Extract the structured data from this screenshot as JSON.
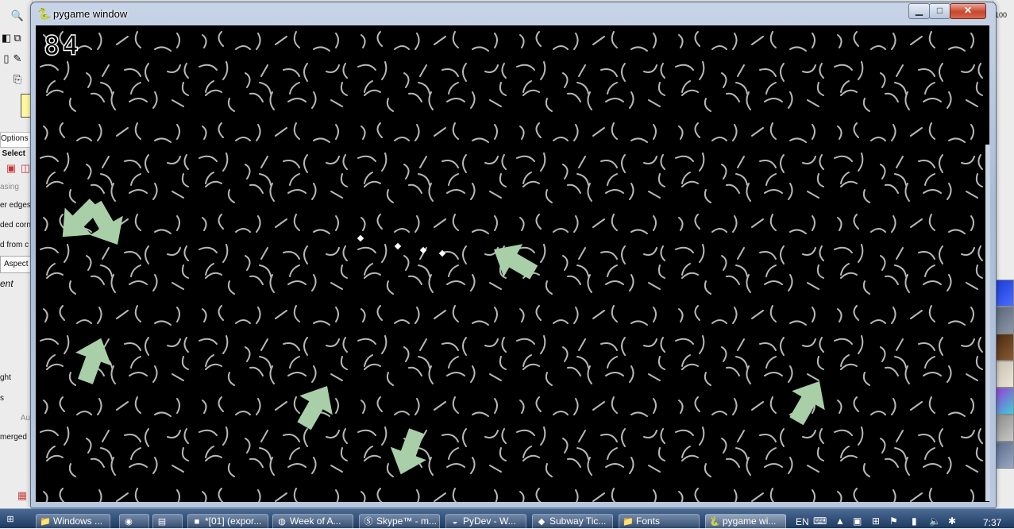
{
  "window": {
    "title": "pygame window",
    "minimize_glyph": "▁",
    "maximize_glyph": "□",
    "close_glyph": "✕"
  },
  "game": {
    "score": "84",
    "background_color": "#000000",
    "scribble_color": "#b8b8b8",
    "arrow_color": "#a9cfa9",
    "bullet_color": "#ffffff",
    "bullet_count": 4,
    "enemy_arrow_count": 8
  },
  "background_app": {
    "options_tab": "Options",
    "select_label": "Select",
    "row_asing": "asing",
    "row_edges": "er edges",
    "row_corn": "ded corn",
    "row_from": "d from c",
    "aspect_button": "Aspect",
    "ent_label": "ent",
    "ght_label": "ght",
    "s_label": "s",
    "au_label": "Au",
    "merged_label": "merged",
    "right_edge_value": "100"
  },
  "taskbar": {
    "tasks": [
      {
        "label": "Windows ...",
        "icon": "folder-icon"
      },
      {
        "label": "",
        "icon": "blender-icon"
      },
      {
        "label": "",
        "icon": "document-icon"
      },
      {
        "label": "*[01] (expor...",
        "icon": "gimp-icon"
      },
      {
        "label": "Week of A...",
        "icon": "firefox-icon"
      },
      {
        "label": "Skype™ - m...",
        "icon": "skype-icon"
      },
      {
        "label": "PyDev - W...",
        "icon": "eclipse-icon"
      },
      {
        "label": "Subway Tic...",
        "icon": "app-icon"
      },
      {
        "label": "Fonts",
        "icon": "folder-icon"
      },
      {
        "label": "pygame wi...",
        "icon": "pygame-icon"
      }
    ],
    "language": "EN",
    "time": "7:37"
  }
}
